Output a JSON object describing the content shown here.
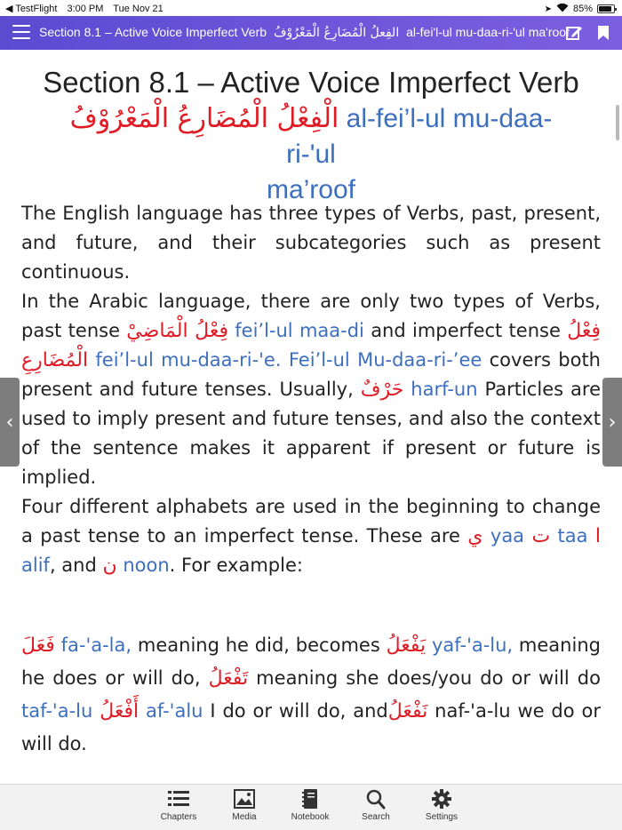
{
  "status_bar": {
    "back_app": "◀ TestFlight",
    "time": "3:00 PM",
    "date": "Tue Nov 21",
    "battery": "85%",
    "battery_level": 0.85
  },
  "navbar": {
    "title_en": "Section 8.1 – Active Voice Imperfect Verb",
    "title_ar": "الفِعلُ الْمُضَارِعُ الْمَعْرُوْفُ",
    "title_translit": "al-fei'l-ul mu-daa-ri-'ul ma'roof"
  },
  "heading": {
    "title": "Section 8.1 – Active Voice Imperfect Verb",
    "arabic": "الْفِعْلُ الْمُضَارِعُ الْمَعْرُوْفُ",
    "translit_1": " al-fei’l-ul mu-daa-ri-'ul",
    "translit_2": "ma’roof"
  },
  "para1": {
    "text_1": "The English language has three types of Verbs, past, present, and future, and their subcategories such as present continuous.",
    "text_2": "In the Arabic language, there are only two types of Verbs, past tense ",
    "ar_past": "فِعْلُ الْمَاضِيْ",
    "tr_past": " fei’l-ul maa-di",
    "text_3": " and imperfect tense ",
    "ar_imperfect": "فِعْلُ الْمُضَارِعِ",
    "tr_imperfect": "  fei’l-ul mu-daa-ri-'e. Fei’l-ul Mu-daa-ri-’ee",
    "text_4": " covers both present and future tenses. Usually, ",
    "ar_harf": "حَرْفٌ",
    "tr_harf": "harf-un",
    "text_5": " Particles are used to imply present and future tenses, and also the context of the sentence makes it apparent if present or future is implied.",
    "text_6": "Four different alphabets are used in the beginning to change a past tense to an imperfect tense. These are ",
    "ar_yaa": "ي",
    "tr_yaa": " yaa ",
    "ar_taa": "ت",
    "tr_taa": " taa ",
    "ar_alif": "ا",
    "tr_alif": " alif",
    "text_7": ", and ",
    "ar_noon": "ن",
    "tr_noon": " noon",
    "text_8": ". For example:"
  },
  "para2": {
    "ar_1": "فَعَلَ",
    "tr_1": " fa-'a-la,",
    "text_1": " meaning he did, becomes ",
    "ar_2": "يَفْعَلُ",
    "tr_2": " yaf-'a-lu,",
    "text_2": " meaning he does or will do, ",
    "ar_3": "تَفْعَلُ",
    "text_3": " meaning she does/you do or will do ",
    "tr_3": "taf-'a-lu ",
    "ar_4": "أَفْعَلُ",
    "tr_4": " af-'alu",
    "text_4": " I do or will do, and",
    "ar_5": "نَفْعَلُ",
    "text_5": " naf-'a-lu we do or will do."
  },
  "tabs": [
    {
      "label": "Chapters",
      "icon": "list-icon"
    },
    {
      "label": "Media",
      "icon": "image-icon"
    },
    {
      "label": "Notebook",
      "icon": "notebook-icon"
    },
    {
      "label": "Search",
      "icon": "search-icon"
    },
    {
      "label": "Settings",
      "icon": "gear-icon"
    }
  ],
  "colors": {
    "navbar": "#6a53d8",
    "arabic_red": "#e01b24",
    "translit_blue": "#3d6fbf"
  }
}
